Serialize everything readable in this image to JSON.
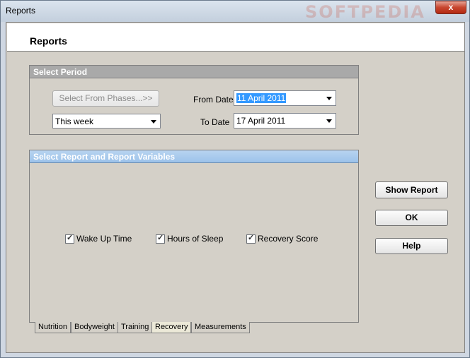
{
  "window": {
    "title": "Reports",
    "watermark": "SOFTPEDIA",
    "close_glyph": "x"
  },
  "header": {
    "title": "Reports"
  },
  "period": {
    "title": "Select Period",
    "phases_button": "Select From Phases...>>",
    "preset": "This week",
    "from_label": "From Date",
    "from_value": "11 April 2011",
    "to_label": "To Date",
    "to_value": "17 April 2011"
  },
  "report": {
    "title": "Select Report and Report Variables",
    "variables": [
      {
        "label": "Wake Up Time",
        "checked": true
      },
      {
        "label": "Hours of Sleep",
        "checked": true
      },
      {
        "label": "Recovery Score",
        "checked": true
      }
    ]
  },
  "tabs": [
    "Nutrition",
    "Bodyweight",
    "Training",
    "Recovery",
    "Measurements"
  ],
  "active_tab": "Recovery",
  "actions": {
    "show_report": "Show Report",
    "ok": "OK",
    "help": "Help"
  },
  "colors": {
    "selection": "#3399ff",
    "group_head_gray": "#a9a9a9",
    "group_head_blue": "#9cc2ea",
    "close_red": "#c7462f"
  }
}
